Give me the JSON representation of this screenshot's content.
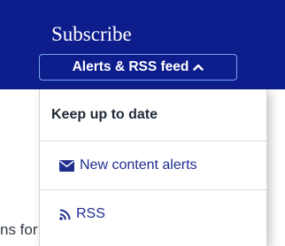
{
  "header": {
    "title": "Subscribe",
    "toggle_label": "Alerts & RSS feed",
    "toggle_icon": "chevron-up-icon"
  },
  "dropdown": {
    "heading": "Keep up to date",
    "items": [
      {
        "label": "New content alerts",
        "icon": "envelope-icon"
      },
      {
        "label": "RSS",
        "icon": "rss-icon"
      }
    ]
  },
  "background": {
    "partial_text": "ns for authors"
  },
  "colors": {
    "header_bg": "#0e1d8c",
    "link": "#1f2f8f",
    "toggle_border": "#7aa4f0"
  }
}
